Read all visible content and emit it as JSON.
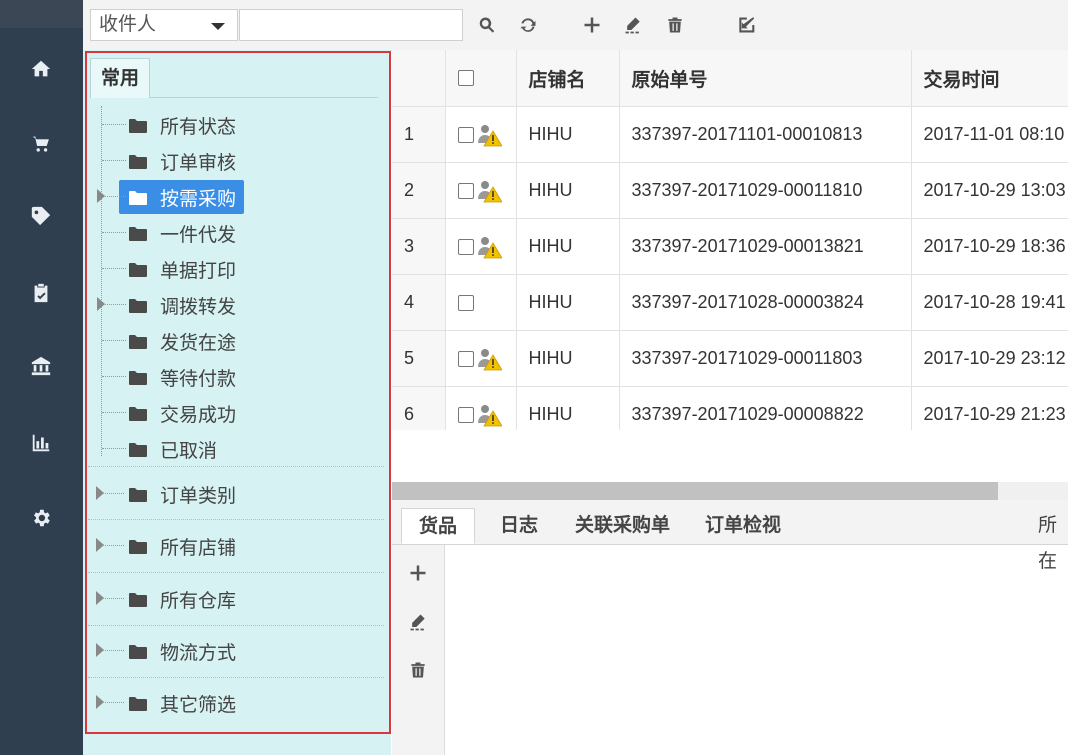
{
  "toolbar": {
    "field_select": "收件人",
    "search_value": "",
    "search_placeholder": ""
  },
  "nav": {
    "icons": [
      "home-icon",
      "cart-icon",
      "tag-icon",
      "clipboard-check-icon",
      "bank-icon",
      "bar-chart-icon",
      "gear-icon"
    ]
  },
  "tree": {
    "tab_label": "常用",
    "items": [
      {
        "label": "所有状态",
        "expandable": false,
        "selected": false
      },
      {
        "label": "订单审核",
        "expandable": false,
        "selected": false
      },
      {
        "label": "按需采购",
        "expandable": true,
        "selected": true
      },
      {
        "label": "一件代发",
        "expandable": false,
        "selected": false
      },
      {
        "label": "单据打印",
        "expandable": false,
        "selected": false
      },
      {
        "label": "调拨转发",
        "expandable": true,
        "selected": false
      },
      {
        "label": "发货在途",
        "expandable": false,
        "selected": false
      },
      {
        "label": "等待付款",
        "expandable": false,
        "selected": false
      },
      {
        "label": "交易成功",
        "expandable": false,
        "selected": false
      },
      {
        "label": "已取消",
        "expandable": false,
        "selected": false
      }
    ],
    "groups": [
      {
        "label": "订单类别"
      },
      {
        "label": "所有店铺"
      },
      {
        "label": "所有仓库"
      },
      {
        "label": "物流方式"
      },
      {
        "label": "其它筛选"
      }
    ]
  },
  "grid": {
    "columns": [
      "店铺名",
      "原始单号",
      "交易时间"
    ],
    "rows": [
      {
        "num": "1",
        "warn": true,
        "shop": "HIHU",
        "order": "337397-20171101-00010813",
        "time": "2017-11-01 08:10"
      },
      {
        "num": "2",
        "warn": true,
        "shop": "HIHU",
        "order": "337397-20171029-00011810",
        "time": "2017-10-29 13:03"
      },
      {
        "num": "3",
        "warn": true,
        "shop": "HIHU",
        "order": "337397-20171029-00013821",
        "time": "2017-10-29 18:36"
      },
      {
        "num": "4",
        "warn": false,
        "shop": "HIHU",
        "order": "337397-20171028-00003824",
        "time": "2017-10-28 19:41"
      },
      {
        "num": "5",
        "warn": true,
        "shop": "HIHU",
        "order": "337397-20171029-00011803",
        "time": "2017-10-29 23:12"
      },
      {
        "num": "6",
        "warn": true,
        "shop": "HIHU",
        "order": "337397-20171029-00008822",
        "time": "2017-10-29 21:23"
      }
    ]
  },
  "bottom": {
    "tabs": [
      "货品",
      "日志",
      "关联采购单",
      "订单检视"
    ],
    "right_label": "所在"
  },
  "colors": {
    "nav_bg": "#2f3f50",
    "panel_bg": "#d6f2f3",
    "selected_bg": "#3a8ee6",
    "highlight_border": "#d9363e"
  }
}
